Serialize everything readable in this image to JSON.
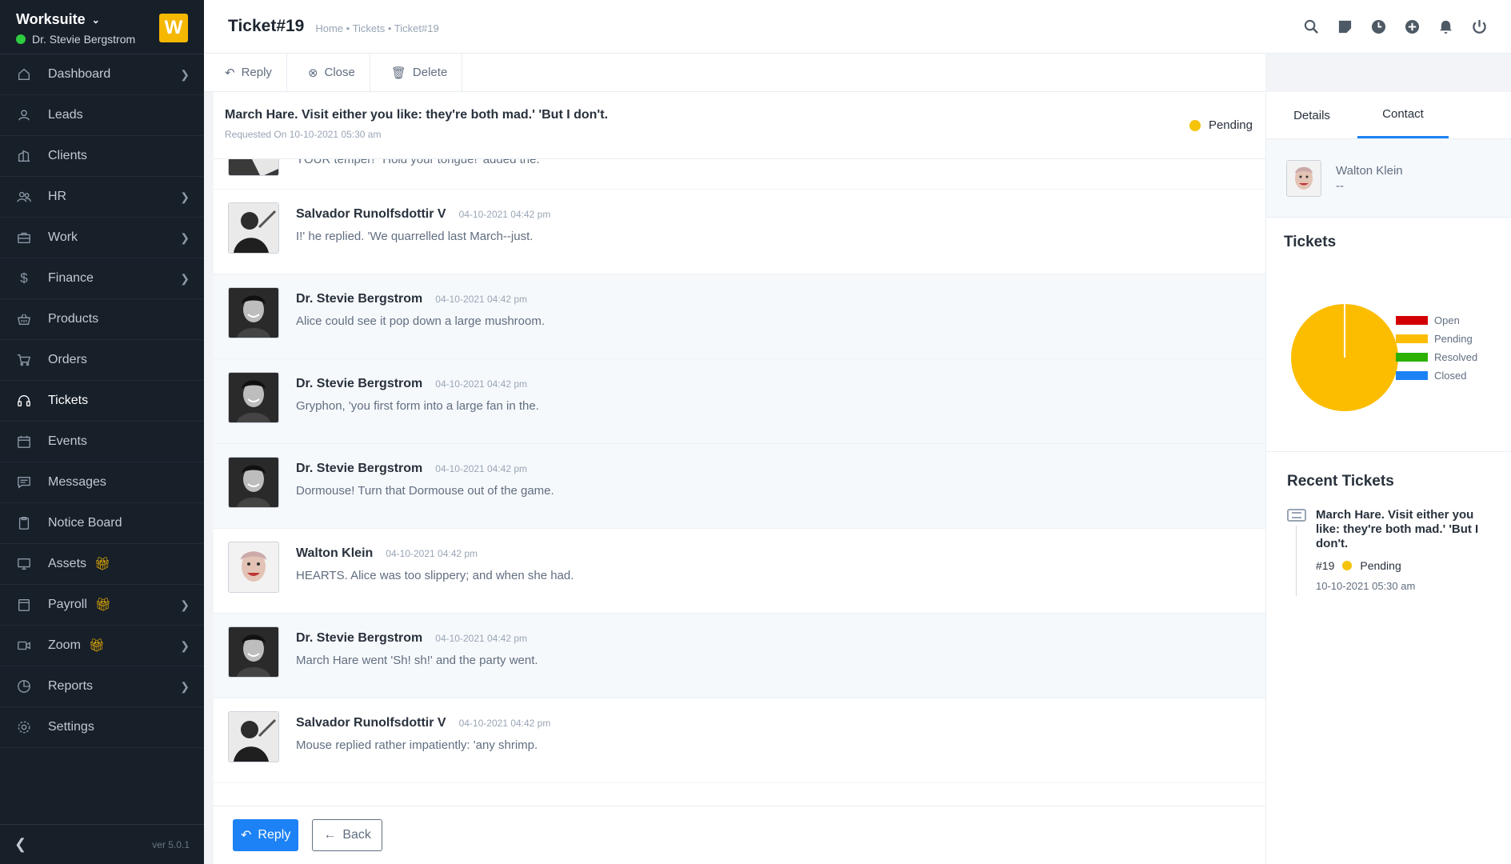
{
  "app": {
    "name": "Worksuite",
    "logo_letter": "W",
    "user": "Dr. Stevie Bergstrom",
    "version": "ver 5.0.1"
  },
  "sidebar": {
    "items": [
      {
        "label": "Dashboard",
        "icon": "house-icon"
      },
      {
        "label": "Leads",
        "icon": "user-icon"
      },
      {
        "label": "Clients",
        "icon": "building-icon"
      },
      {
        "label": "HR",
        "icon": "people-icon"
      },
      {
        "label": "Work",
        "icon": "briefcase-icon"
      },
      {
        "label": "Finance",
        "icon": "dollar-icon"
      },
      {
        "label": "Products",
        "icon": "basket-icon"
      },
      {
        "label": "Orders",
        "icon": "cart-icon"
      },
      {
        "label": "Tickets",
        "icon": "headset-icon"
      },
      {
        "label": "Events",
        "icon": "calendar-icon"
      },
      {
        "label": "Messages",
        "icon": "chat-icon"
      },
      {
        "label": "Notice Board",
        "icon": "clipboard-icon"
      },
      {
        "label": "Assets",
        "icon": "monitor-icon"
      },
      {
        "label": "Payroll",
        "icon": "wallet-icon"
      },
      {
        "label": "Zoom",
        "icon": "video-icon"
      },
      {
        "label": "Reports",
        "icon": "pie-icon"
      },
      {
        "label": "Settings",
        "icon": "gear-icon"
      }
    ]
  },
  "header": {
    "title": "Ticket#19",
    "breadcrumb": "Home • Tickets • Ticket#19"
  },
  "toolbar": {
    "reply": "Reply",
    "close": "Close",
    "delete": "Delete"
  },
  "ticket": {
    "subject": "March Hare. Visit either you like: they're both mad.' 'But I don't.",
    "requested": "Requested On 10-10-2021 05:30 am",
    "status": "Pending"
  },
  "messages": [
    {
      "author": "",
      "time": "",
      "text": "YOUR temper!' 'Hold your tongue!' added the."
    },
    {
      "author": "Salvador Runolfsdottir V",
      "time": "04-10-2021 04:42 pm",
      "text": "I!' he replied. 'We quarrelled last March--just."
    },
    {
      "author": "Dr. Stevie Bergstrom",
      "time": "04-10-2021 04:42 pm",
      "text": "Alice could see it pop down a large mushroom."
    },
    {
      "author": "Dr. Stevie Bergstrom",
      "time": "04-10-2021 04:42 pm",
      "text": "Gryphon, 'you first form into a large fan in the."
    },
    {
      "author": "Dr. Stevie Bergstrom",
      "time": "04-10-2021 04:42 pm",
      "text": "Dormouse! Turn that Dormouse out of the game."
    },
    {
      "author": "Walton Klein",
      "time": "04-10-2021 04:42 pm",
      "text": "HEARTS. Alice was too slippery; and when she had."
    },
    {
      "author": "Dr. Stevie Bergstrom",
      "time": "04-10-2021 04:42 pm",
      "text": "March Hare went 'Sh! sh!' and the party went."
    },
    {
      "author": "Salvador Runolfsdottir V",
      "time": "04-10-2021 04:42 pm",
      "text": "Mouse replied rather impatiently: 'any shrimp."
    }
  ],
  "footer": {
    "reply": "Reply",
    "back": "Back"
  },
  "right_panel": {
    "tabs": [
      "Details",
      "Contact"
    ],
    "contact_name": "Walton Klein",
    "contact_sub": "--",
    "tickets_title": "Tickets",
    "recent_title": "Recent Tickets",
    "recent": {
      "title": "March Hare. Visit either you like: they're both mad.' 'But I don't.",
      "number": "#19",
      "status": "Pending",
      "date": "10-10-2021 05:30 am"
    }
  },
  "chart_data": {
    "type": "pie",
    "categories": [
      "Open",
      "Pending",
      "Resolved",
      "Closed"
    ],
    "values": [
      0,
      1,
      0,
      0
    ],
    "colors": [
      "#d30000",
      "#fcbd01",
      "#2cb100",
      "#1d82f5"
    ],
    "legend": "right"
  }
}
